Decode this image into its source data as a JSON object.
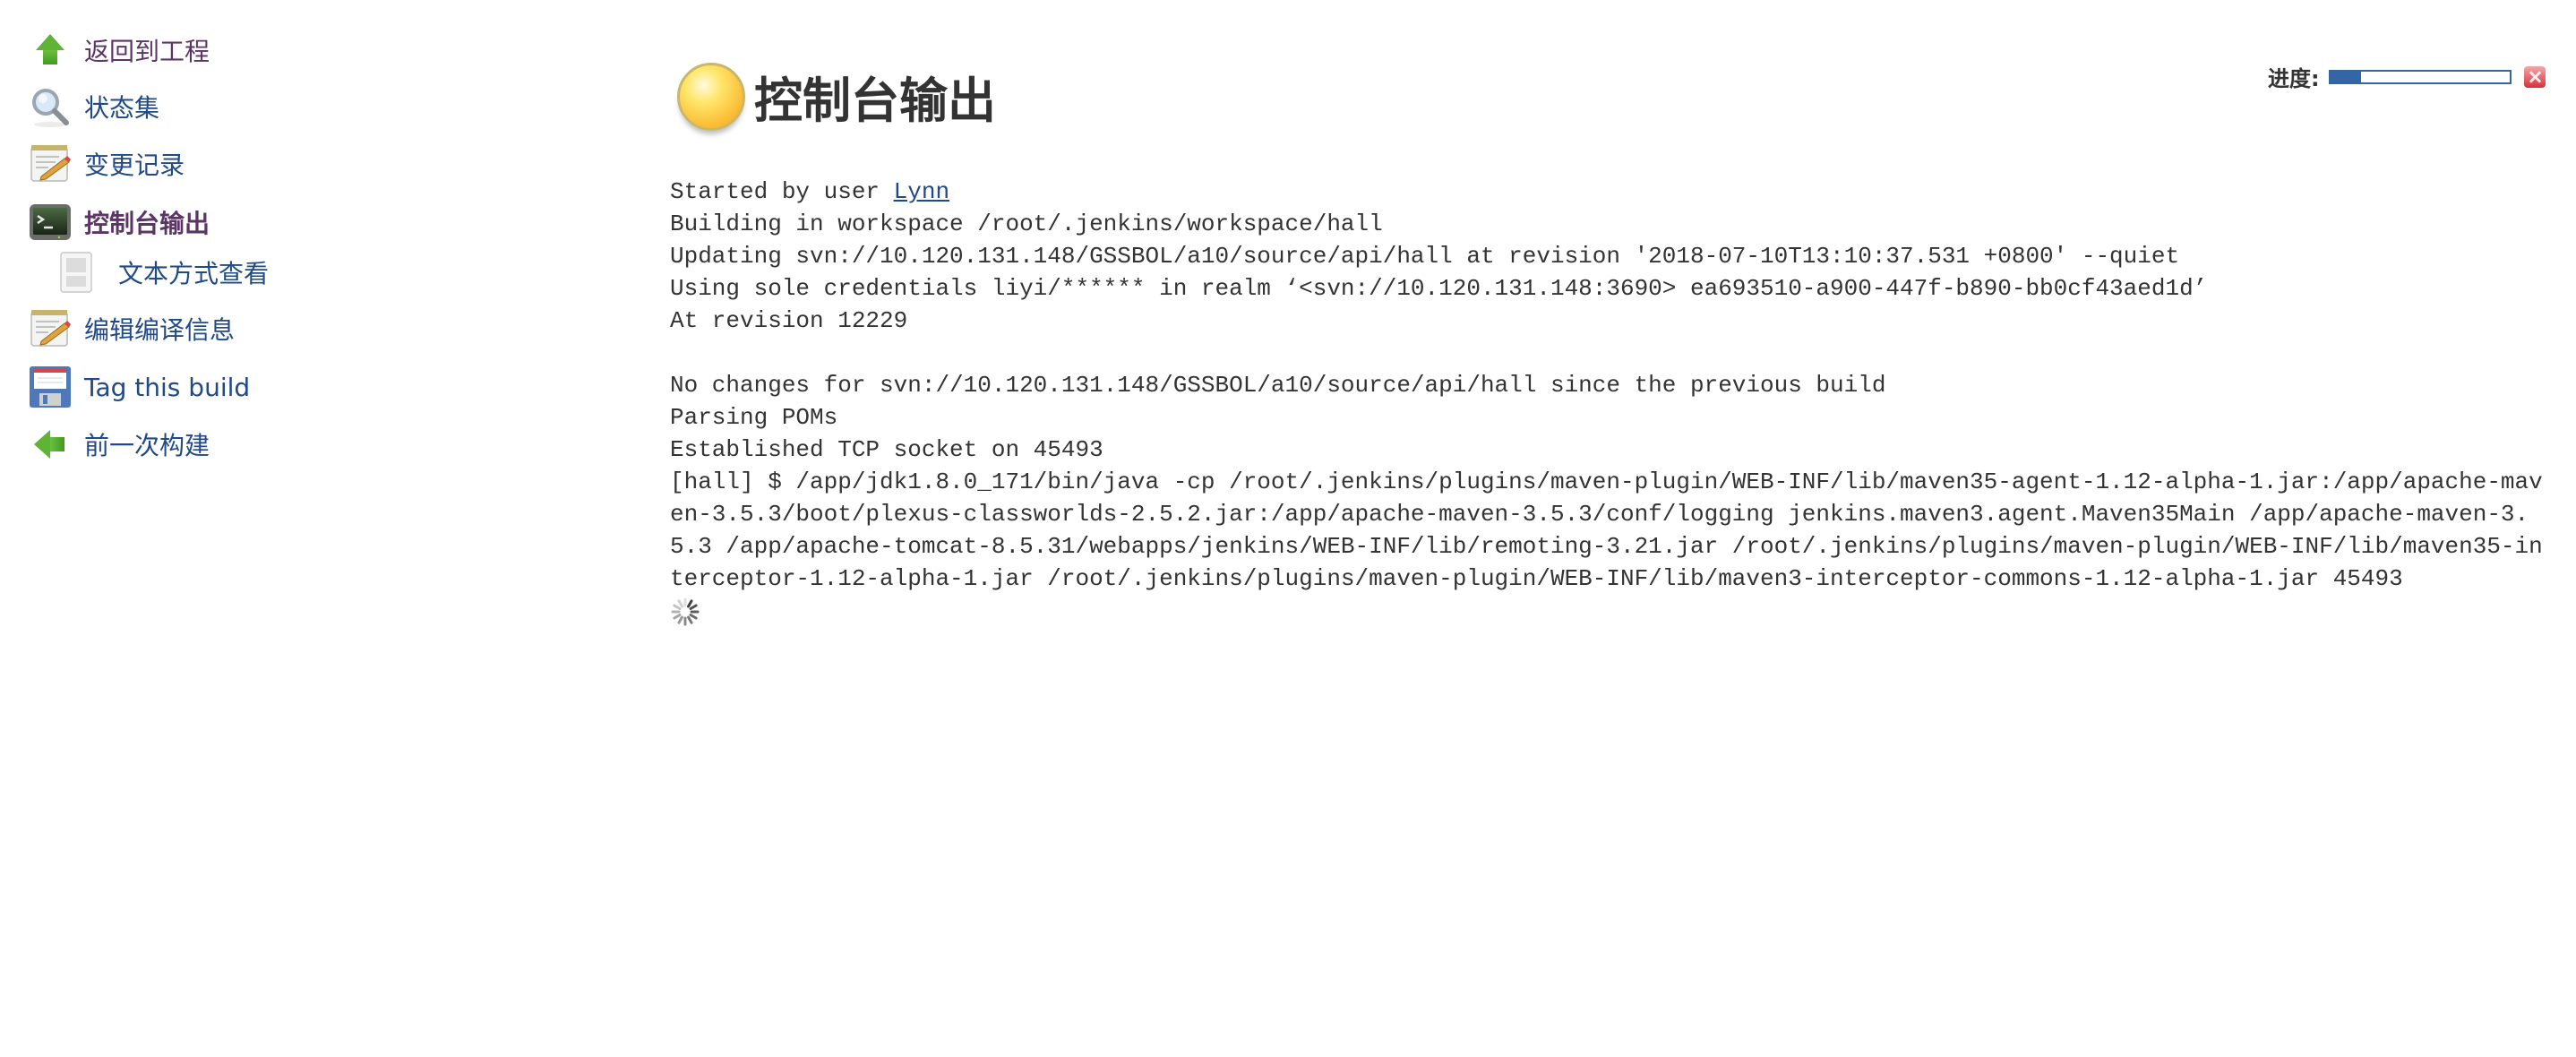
{
  "sidebar": {
    "items": [
      {
        "label": "返回到工程",
        "icon": "arrow-up-icon",
        "state": "visited"
      },
      {
        "label": "状态集",
        "icon": "magnifier-icon",
        "state": "normal"
      },
      {
        "label": "变更记录",
        "icon": "notepad-pencil-icon",
        "state": "normal"
      },
      {
        "label": "控制台输出",
        "icon": "terminal-icon",
        "state": "current"
      },
      {
        "label": "文本方式查看",
        "icon": "document-icon",
        "state": "sub"
      },
      {
        "label": "编辑编译信息",
        "icon": "notepad-pencil-icon",
        "state": "normal"
      },
      {
        "label": "Tag this build",
        "icon": "floppy-disk-icon",
        "state": "normal"
      },
      {
        "label": "前一次构建",
        "icon": "arrow-left-icon",
        "state": "normal"
      }
    ]
  },
  "header": {
    "title": "控制台输出",
    "status_icon": "yellow-ball-icon"
  },
  "progress": {
    "label": "进度:",
    "percent": 17,
    "stop_icon": "stop-build-icon",
    "color": "#3465a4"
  },
  "console": {
    "started_prefix": "Started by user ",
    "user_link": "Lynn",
    "lines": [
      "Building in workspace /root/.jenkins/workspace/hall",
      "Updating svn://10.120.131.148/GSSBOL/a10/source/api/hall at revision '2018-07-10T13:10:37.531 +0800' --quiet",
      "Using sole credentials liyi/****** in realm ‘<svn://10.120.131.148:3690> ea693510-a900-447f-b890-bb0cf43aed1d’",
      "At revision 12229",
      "",
      "No changes for svn://10.120.131.148/GSSBOL/a10/source/api/hall since the previous build",
      "Parsing POMs",
      "Established TCP socket on 45493",
      "[hall] $ /app/jdk1.8.0_171/bin/java -cp /root/.jenkins/plugins/maven-plugin/WEB-INF/lib/maven35-agent-1.12-alpha-1.jar:/app/apache-maven-3.5.3/boot/plexus-classworlds-2.5.2.jar:/app/apache-maven-3.5.3/conf/logging jenkins.maven3.agent.Maven35Main /app/apache-maven-3.5.3 /app/apache-tomcat-8.5.31/webapps/jenkins/WEB-INF/lib/remoting-3.21.jar /root/.jenkins/plugins/maven-plugin/WEB-INF/lib/maven35-interceptor-1.12-alpha-1.jar /root/.jenkins/plugins/maven-plugin/WEB-INF/lib/maven3-interceptor-commons-1.12-alpha-1.jar 45493"
    ],
    "spinner_icon": "loading-spinner-icon"
  },
  "colors": {
    "link": "#204a87",
    "visited_link": "#5c3566",
    "text": "#333333"
  }
}
